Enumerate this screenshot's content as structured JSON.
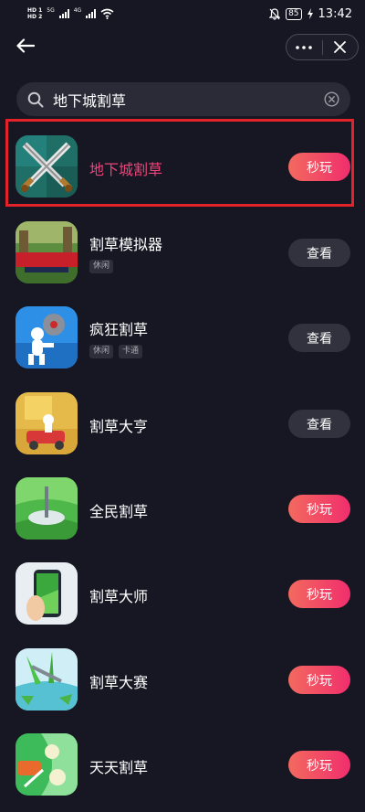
{
  "status_bar": {
    "hd1": "HD 1",
    "hd2": "HD 2",
    "net1": "5G",
    "net2": "4G",
    "battery": "85",
    "time": "13:42",
    "icons": [
      "wifi-icon",
      "mute-icon",
      "battery-icon",
      "charging-icon"
    ]
  },
  "nav": {
    "back_icon": "arrow-left-icon",
    "more_icon": "more-dots-icon",
    "close_icon": "close-icon"
  },
  "search": {
    "query": "地下城割草",
    "icon": "search-icon",
    "clear_icon": "clear-circle-icon"
  },
  "colors": {
    "background": "#161722",
    "highlight_title": "#f0437a",
    "play_button": "#f02e6d",
    "view_button": "#31323d",
    "highlight_border": "#e3222a"
  },
  "results": [
    {
      "title": "地下城割草",
      "tags": [],
      "action": "秒玩",
      "icon": "crossed-swords-icon"
    },
    {
      "title": "割草模拟器",
      "tags": [
        "休闲"
      ],
      "action": "查看",
      "icon": "mowing-simulator-icon"
    },
    {
      "title": "疯狂割草",
      "tags": [
        "休闲",
        "卡通"
      ],
      "action": "查看",
      "icon": "saw-blade-runner-icon"
    },
    {
      "title": "割草大亨",
      "tags": [],
      "action": "查看",
      "icon": "lawn-mower-icon"
    },
    {
      "title": "全民割草",
      "tags": [],
      "action": "秒玩",
      "icon": "spinning-blade-icon"
    },
    {
      "title": "割草大师",
      "tags": [],
      "action": "秒玩",
      "icon": "phone-grass-icon"
    },
    {
      "title": "割草大赛",
      "tags": [],
      "action": "秒玩",
      "icon": "grass-cutter-icon"
    },
    {
      "title": "天天割草",
      "tags": [],
      "action": "秒玩",
      "icon": "vs-battle-icon"
    }
  ]
}
